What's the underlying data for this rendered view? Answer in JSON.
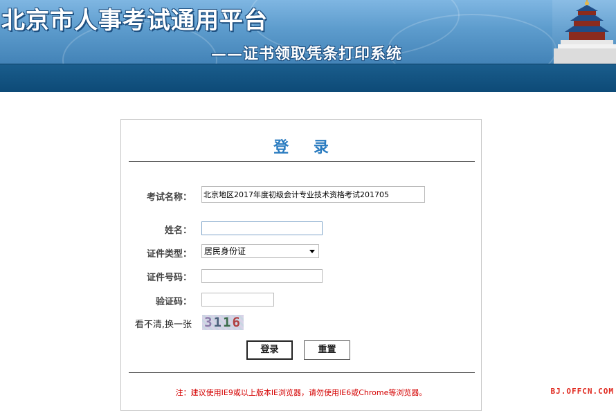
{
  "header": {
    "title": "北京市人事考试通用平台",
    "subtitle": "——证书领取凭条打印系统"
  },
  "login": {
    "title": "登 录",
    "fields": {
      "exam_name_label": "考试名称：",
      "exam_name_value": "北京地区2017年度初级会计专业技术资格考试201705",
      "name_label": "姓名：",
      "name_value": "",
      "id_type_label": "证件类型：",
      "id_type_value": "居民身份证",
      "id_number_label": "证件号码：",
      "id_number_value": "",
      "captcha_label": "验证码：",
      "captcha_value": "",
      "refresh_label": "看不清,换一张"
    },
    "captcha_digits": [
      "3",
      "1",
      "1",
      "6"
    ],
    "buttons": {
      "login": "登录",
      "reset": "重置"
    },
    "note": "注：建议使用IE9或以上版本IE浏览器，请勿使用IE6或Chrome等浏览器。"
  },
  "watermark": "BJ.OFFCN.COM",
  "colors": {
    "banner_top": "#7fb6e2",
    "nav_bar": "#0d4a77",
    "title_blue": "#2b7cc0",
    "note_red": "#d40000"
  },
  "icons": {
    "temple": "temple-of-heaven-icon",
    "select_arrow": "chevron-down-icon"
  }
}
